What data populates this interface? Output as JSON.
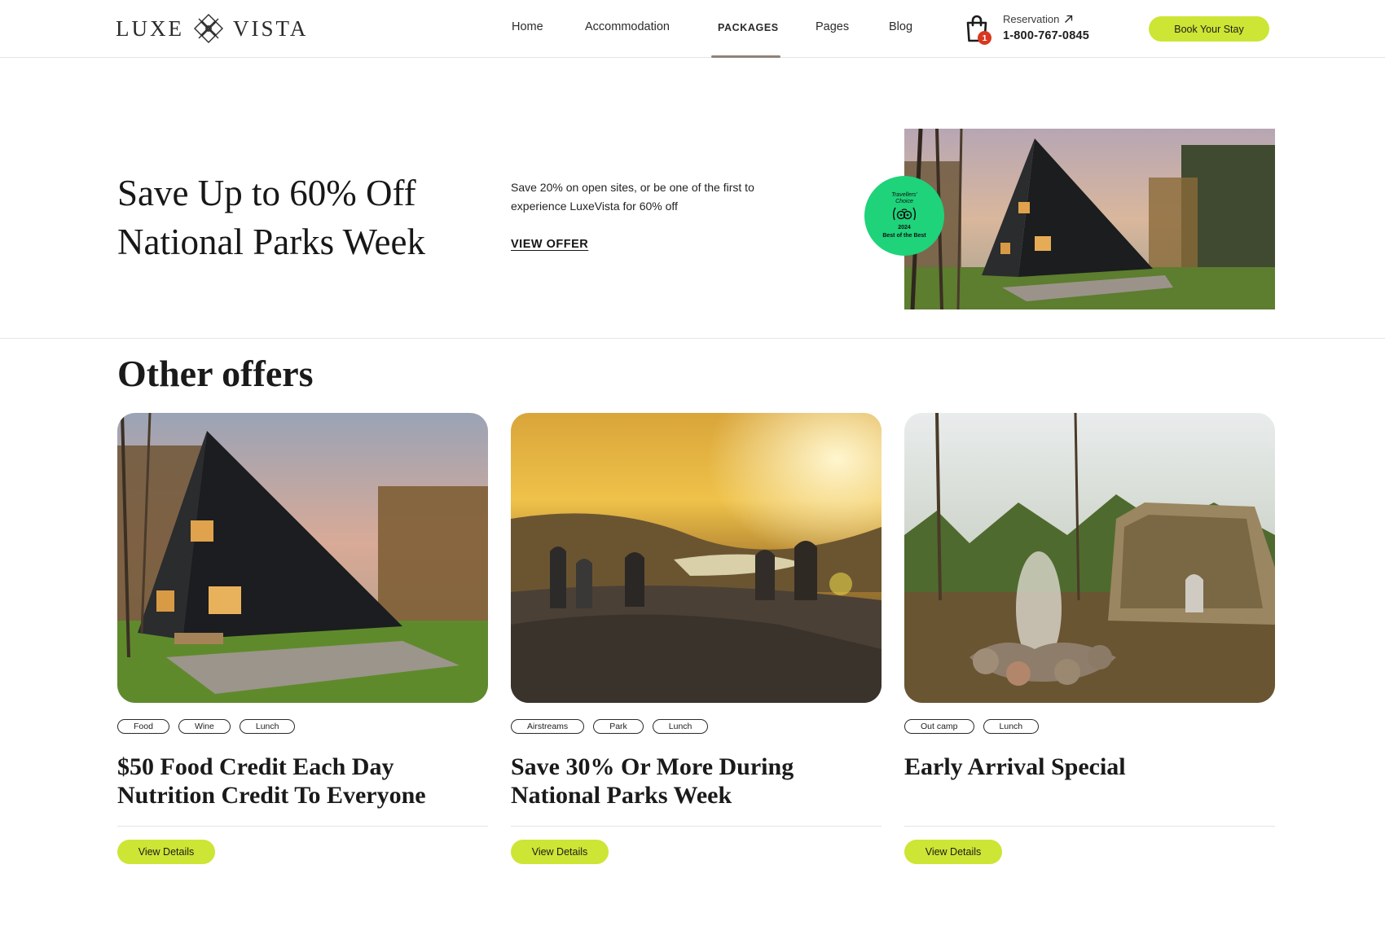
{
  "brand": {
    "left_word": "LUXE",
    "right_word": "VISTA"
  },
  "nav": {
    "items": [
      {
        "label": "Home"
      },
      {
        "label": "Accommodation"
      },
      {
        "label": "PACKAGES"
      },
      {
        "label": "Pages"
      },
      {
        "label": "Blog"
      }
    ],
    "active_index": 2
  },
  "cart": {
    "count": "1",
    "icon": "shopping-bag-icon"
  },
  "reservation": {
    "label": "Reservation",
    "icon": "arrow-up-right-icon",
    "phone": "1-800-767-0845"
  },
  "header": {
    "book_label": "Book Your Stay"
  },
  "hero": {
    "title_line1": "Save Up to 60% Off",
    "title_line2": "National Parks Week",
    "description": "Save 20% on open sites, or be one of the first to experience LuxeVista for 60% off",
    "link_label": "VIEW OFFER",
    "badge": {
      "line1": "Travellers'",
      "line2": "Choice",
      "year": "2024",
      "line3": "Best of the Best"
    }
  },
  "offers": {
    "title": "Other offers",
    "cards": [
      {
        "tags": [
          "Food",
          "Wine",
          "Lunch"
        ],
        "title": "$50 Food Credit Each Day Nutrition Credit To Everyone",
        "button": "View Details"
      },
      {
        "tags": [
          "Airstreams",
          "Park",
          "Lunch"
        ],
        "title": "Save 30% Or More During National Parks Week",
        "button": "View Details"
      },
      {
        "tags": [
          "Out camp",
          "Lunch"
        ],
        "title": "Early Arrival Special",
        "button": "View Details"
      }
    ]
  },
  "colors": {
    "accent": "#cde534",
    "badge": "#1ed37a",
    "cart_badge": "#d9371f",
    "nav_underline": "#8f8377"
  }
}
